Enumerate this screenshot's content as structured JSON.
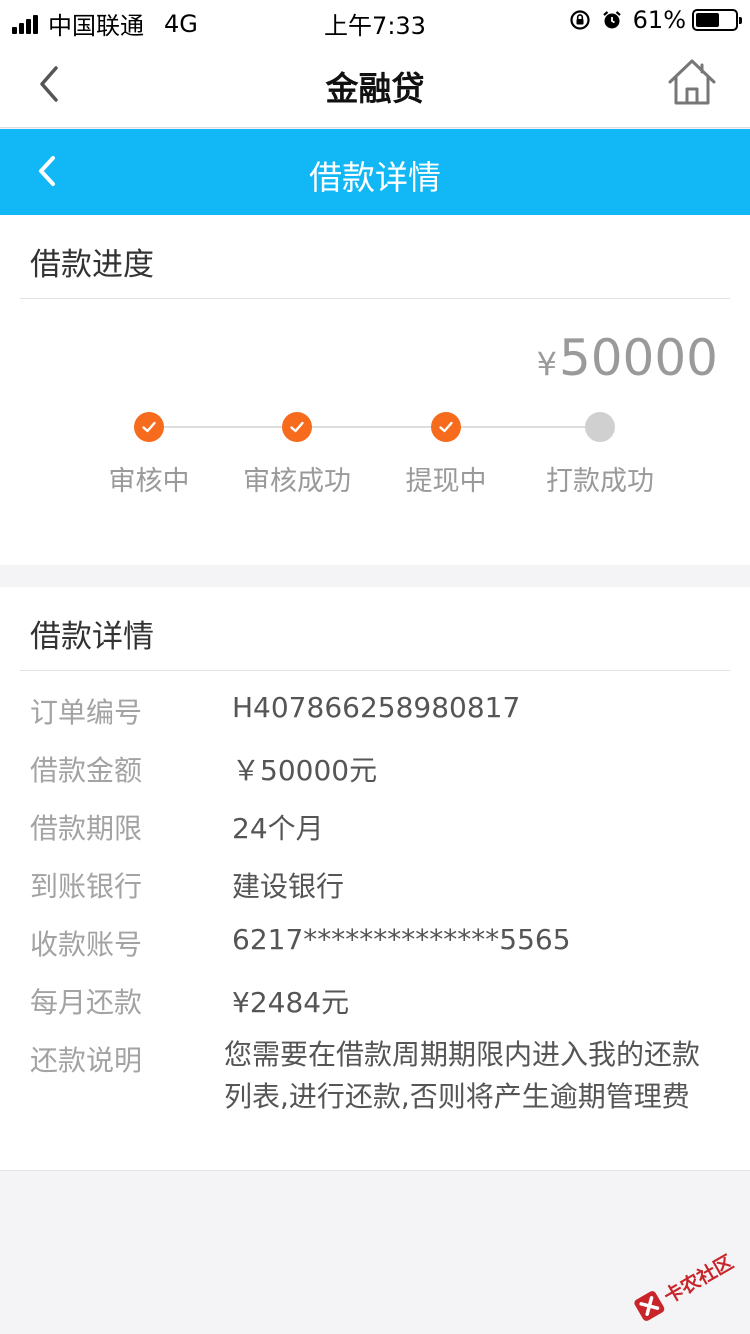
{
  "status_bar": {
    "carrier": "中国联通",
    "network": "4G",
    "time": "上午7:33",
    "battery_percent_text": "61%",
    "battery_level": 0.61
  },
  "nav_white": {
    "title": "金融贷",
    "back_icon": "chevron-left-icon",
    "home_icon": "home-icon"
  },
  "nav_blue": {
    "title": "借款详情",
    "back_icon": "chevron-left-icon",
    "background_color": "#12b7f5"
  },
  "progress": {
    "section_title": "借款进度",
    "currency": "¥",
    "amount": "50000",
    "steps": [
      {
        "label": "审核中",
        "done": true
      },
      {
        "label": "审核成功",
        "done": true
      },
      {
        "label": "提现中",
        "done": true
      },
      {
        "label": "打款成功",
        "done": false
      }
    ],
    "done_color": "#f76b1c"
  },
  "details": {
    "section_title": "借款详情",
    "rows": [
      {
        "label": "订单编号",
        "value": "H407866258980817"
      },
      {
        "label": "借款金额",
        "value": "￥50000元"
      },
      {
        "label": "借款期限",
        "value": "24个月"
      },
      {
        "label": "到账银行",
        "value": "建设银行"
      },
      {
        "label": "收款账号",
        "value": "6217**************5565"
      },
      {
        "label": "每月还款",
        "value": "¥2484元"
      }
    ],
    "note_label": "还款说明",
    "note_value": "您需要在借款周期期限内进入我的还款列表,进行还款,否则将产生逾期管理费"
  },
  "watermark": {
    "text": "卡农社区"
  }
}
